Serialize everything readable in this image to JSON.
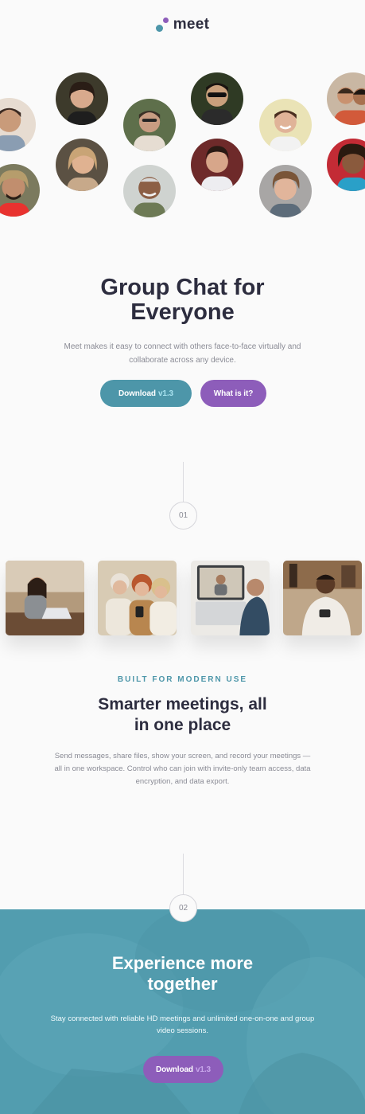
{
  "header": {
    "logo_text": "meet",
    "logo_icon": "two-dot-logo-icon"
  },
  "hero": {
    "title_line1": "Group Chat for",
    "title_line2": "Everyone",
    "subtitle": "Meet makes it easy to connect with others face-to-face virtually and collaborate across any device.",
    "download_label": "Download",
    "download_version": "v1.3",
    "whatisit_label": "What is it?"
  },
  "steps": {
    "first": "01",
    "second": "02"
  },
  "features": {
    "kicker": "BUILT FOR MODERN USE",
    "title_line1": "Smarter meetings, all",
    "title_line2": "in one place",
    "text": "Send messages, share files, show your screen, and record your meetings — all in one workspace. Control who can join with invite-only team access, data encryption, and data export."
  },
  "cta": {
    "title_line1": "Experience more",
    "title_line2": "together",
    "text": "Stay connected with reliable HD meetings and unlimited one-on-one and group video sessions.",
    "download_label": "Download",
    "download_version": "v1.3"
  },
  "colors": {
    "teal": "#4d96a9",
    "purple": "#8d5dba",
    "heading": "#2d2d3f",
    "muted": "#8a8b95",
    "background": "#fafafa"
  }
}
